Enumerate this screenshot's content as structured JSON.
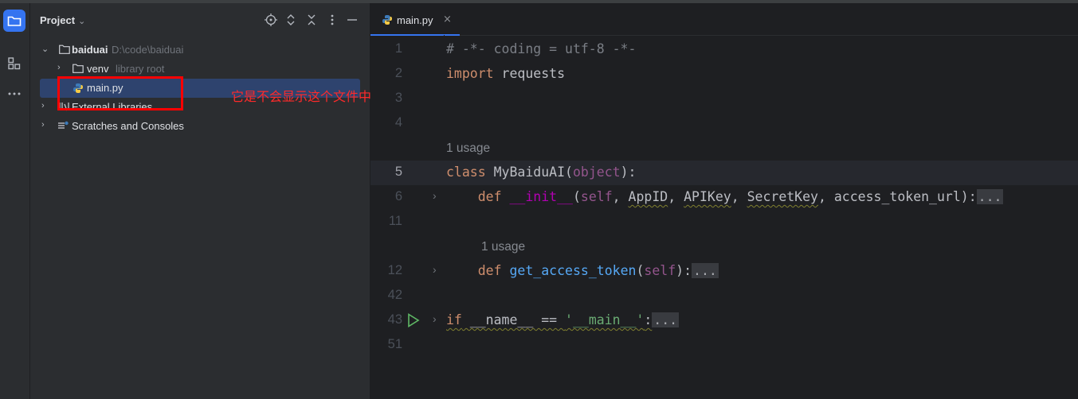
{
  "sidebar_panel": {
    "title": "Project",
    "tree": [
      {
        "label": "baiduai",
        "sub": "D:\\code\\baiduai",
        "icon": "folder-icon",
        "expanded": true
      },
      {
        "label": "venv",
        "sub": "library root",
        "icon": "folder-icon",
        "expanded": false
      },
      {
        "label": "main.py",
        "sub": "",
        "icon": "python-file-icon",
        "selected": true
      },
      {
        "label": "External Libraries",
        "sub": "",
        "icon": "library-icon",
        "expanded": false
      },
      {
        "label": "Scratches and Consoles",
        "sub": "",
        "icon": "scratches-icon",
        "expanded": false
      }
    ]
  },
  "annotation": {
    "text": "它是不会显示这个文件中都有哪些类和方法的",
    "color": "#ff2a2a"
  },
  "editor": {
    "tab_label": "main.py",
    "tab_close": "×",
    "lines": [
      {
        "num": "1",
        "tokens": [
          [
            "cmt",
            "# -*- coding = utf-8 -*-"
          ]
        ]
      },
      {
        "num": "2",
        "tokens": [
          [
            "kw",
            "import"
          ],
          [
            "",
            " requests"
          ]
        ]
      },
      {
        "num": "3",
        "tokens": []
      },
      {
        "num": "4",
        "tokens": []
      },
      {
        "hint": "1 usage"
      },
      {
        "num": "5",
        "current": true,
        "tokens": [
          [
            "kw",
            "class"
          ],
          [
            "",
            " MyBaiduAI("
          ],
          [
            "selfc",
            "object"
          ],
          [
            "",
            "):"
          ]
        ]
      },
      {
        "num": "6",
        "fold": true,
        "tokens": [
          [
            "",
            "    "
          ],
          [
            "kw",
            "def"
          ],
          [
            "",
            " "
          ],
          [
            "magic",
            "__init__"
          ],
          [
            "",
            "("
          ],
          [
            "selfc",
            "self"
          ],
          [
            "",
            ", "
          ],
          [
            "wavy",
            "AppID"
          ],
          [
            "",
            ", "
          ],
          [
            "wavy",
            "APIKey"
          ],
          [
            "",
            ", "
          ],
          [
            "wavy",
            "SecretKey"
          ],
          [
            "",
            ", access_token_url):"
          ],
          [
            "fold-box",
            "..."
          ]
        ]
      },
      {
        "num": "11",
        "tokens": []
      },
      {
        "hint": "1 usage",
        "indent": true
      },
      {
        "num": "12",
        "fold": true,
        "tokens": [
          [
            "",
            "    "
          ],
          [
            "kw",
            "def"
          ],
          [
            "",
            " "
          ],
          [
            "fn",
            "get_access_token"
          ],
          [
            "",
            "("
          ],
          [
            "selfc",
            "self"
          ],
          [
            "",
            "):"
          ],
          [
            "fold-box",
            "..."
          ]
        ]
      },
      {
        "num": "42",
        "tokens": []
      },
      {
        "num": "43",
        "fold": true,
        "run": true,
        "tokens": [
          [
            "kw wavy",
            "if"
          ],
          [
            "wavy",
            " __name__ == "
          ],
          [
            "str wavy",
            "'__main__'"
          ],
          [
            "wavy",
            ":"
          ],
          [
            "fold-box",
            "..."
          ]
        ]
      },
      {
        "num": "51",
        "tokens": []
      }
    ]
  },
  "colors": {
    "accent": "#3574f0",
    "selection": "#2e436e",
    "annotation_box": "#ff0000"
  }
}
